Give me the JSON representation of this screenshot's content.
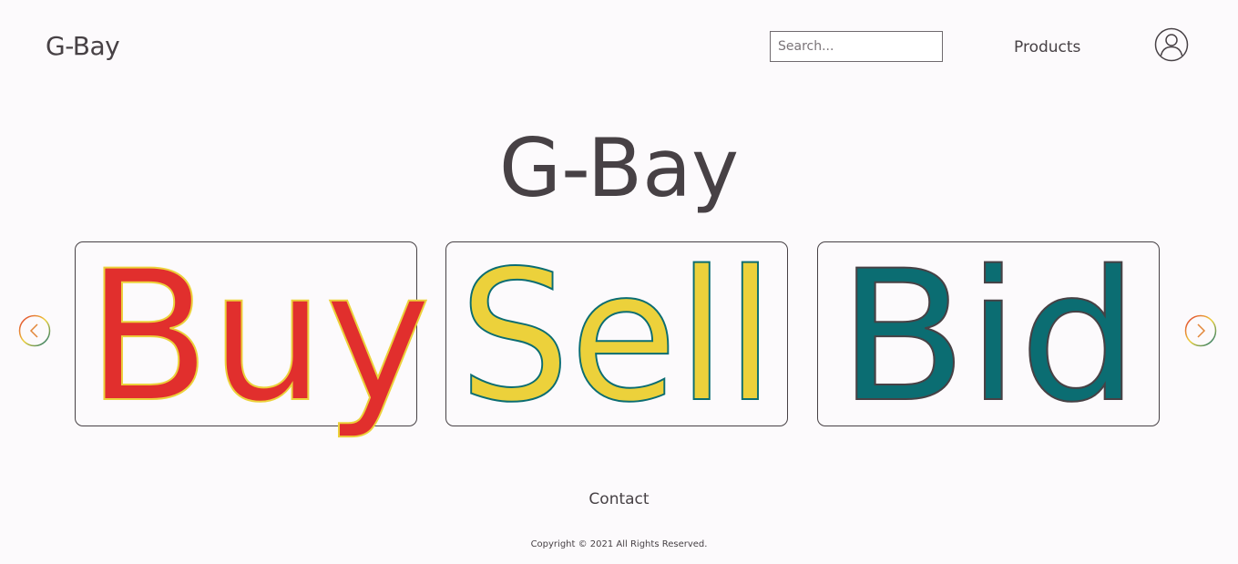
{
  "header": {
    "brand": "G-Bay",
    "search_placeholder": "Search...",
    "search_value": "",
    "nav_products": "Products",
    "account_icon": "user-icon"
  },
  "hero": {
    "title": "G-Bay",
    "cards": [
      {
        "word": "Buy",
        "fill": "#e12f2d",
        "stroke": "#ecd13b"
      },
      {
        "word": "Sell",
        "fill": "#ecd13b",
        "stroke": "#0b6d72"
      },
      {
        "word": "Bid",
        "fill": "#0b6d72",
        "stroke": "#474145"
      }
    ],
    "prev_icon": "chevron-left-icon",
    "next_icon": "chevron-right-icon"
  },
  "footer": {
    "contact": "Contact",
    "copyright": "Copyright © 2021 All Rights Reserved."
  },
  "colors": {
    "background": "#fcfafc",
    "text": "#474145",
    "red": "#e12f2d",
    "yellow": "#ecd13b",
    "teal": "#0b6d72"
  }
}
